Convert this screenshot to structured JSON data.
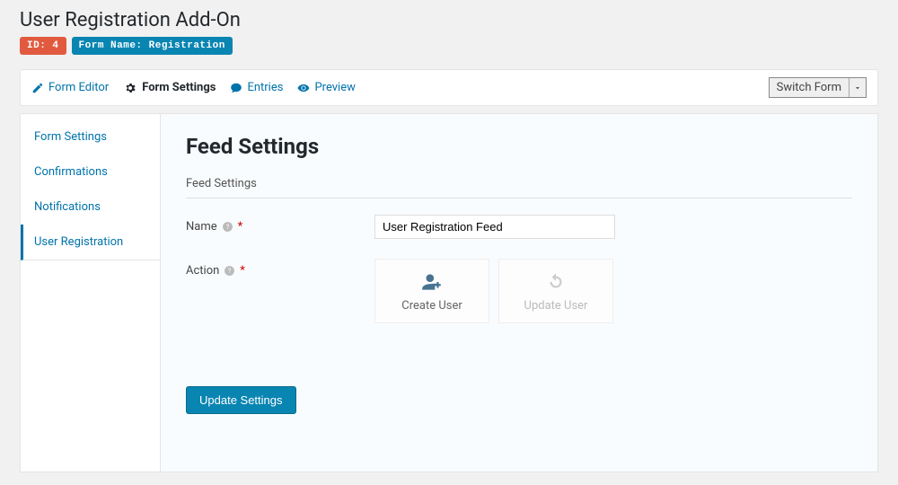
{
  "header": {
    "title": "User Registration Add-On",
    "id_badge": "ID: 4",
    "form_badge": "Form Name: Registration"
  },
  "toolbar": {
    "tabs": {
      "form_editor": "Form Editor",
      "form_settings": "Form Settings",
      "entries": "Entries",
      "preview": "Preview"
    },
    "switch_form": "Switch Form"
  },
  "sidebar": {
    "items": {
      "form_settings": "Form Settings",
      "confirmations": "Confirmations",
      "notifications": "Notifications",
      "user_registration": "User Registration"
    }
  },
  "content": {
    "heading": "Feed Settings",
    "section_label": "Feed Settings",
    "fields": {
      "name_label": "Name",
      "name_value": "User Registration Feed",
      "action_label": "Action",
      "required_mark": "*"
    },
    "actions": {
      "create_user": "Create User",
      "update_user": "Update User"
    },
    "submit_label": "Update Settings"
  }
}
